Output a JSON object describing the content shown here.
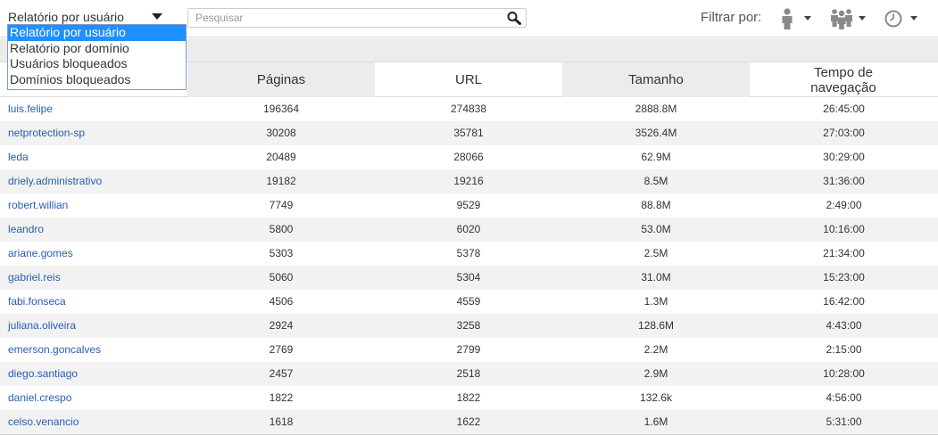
{
  "toolbar": {
    "report_select_value": "Relatório por usuário",
    "search_placeholder": "Pesquisar",
    "filter_label": "Filtrar por:",
    "filter_icons": [
      "user-icon",
      "group-icon",
      "clock-icon"
    ]
  },
  "dropdown": {
    "options": [
      "Relatório por usuário",
      "Relatório por domínio",
      "Usuários bloqueados",
      "Domínios bloqueados"
    ],
    "selected_index": 0,
    "highlight_color": "#1e90ff"
  },
  "table": {
    "headers": [
      "Páginas",
      "URL",
      "Tamanho",
      "Tempo de navegação"
    ],
    "rows": [
      {
        "user": "luis.felipe",
        "paginas": "196364",
        "url": "274838",
        "tamanho": "2888.8M",
        "tempo": "26:45:00"
      },
      {
        "user": "netprotection-sp",
        "paginas": "30208",
        "url": "35781",
        "tamanho": "3526.4M",
        "tempo": "27:03:00"
      },
      {
        "user": "leda",
        "paginas": "20489",
        "url": "28066",
        "tamanho": "62.9M",
        "tempo": "30:29:00"
      },
      {
        "user": "driely.administrativo",
        "paginas": "19182",
        "url": "19216",
        "tamanho": "8.5M",
        "tempo": "31:36:00"
      },
      {
        "user": "robert.willian",
        "paginas": "7749",
        "url": "9529",
        "tamanho": "88.8M",
        "tempo": "2:49:00"
      },
      {
        "user": "leandro",
        "paginas": "5800",
        "url": "6020",
        "tamanho": "53.0M",
        "tempo": "10:16:00"
      },
      {
        "user": "ariane.gomes",
        "paginas": "5303",
        "url": "5378",
        "tamanho": "2.5M",
        "tempo": "21:34:00"
      },
      {
        "user": "gabriel.reis",
        "paginas": "5060",
        "url": "5304",
        "tamanho": "31.0M",
        "tempo": "15:23:00"
      },
      {
        "user": "fabi.fonseca",
        "paginas": "4506",
        "url": "4559",
        "tamanho": "1.3M",
        "tempo": "16:42:00"
      },
      {
        "user": "juliana.oliveira",
        "paginas": "2924",
        "url": "3258",
        "tamanho": "128.6M",
        "tempo": "4:43:00"
      },
      {
        "user": "emerson.goncalves",
        "paginas": "2769",
        "url": "2799",
        "tamanho": "2.2M",
        "tempo": "2:15:00"
      },
      {
        "user": "diego.santiago",
        "paginas": "2457",
        "url": "2518",
        "tamanho": "2.9M",
        "tempo": "10:28:00"
      },
      {
        "user": "daniel.crespo",
        "paginas": "1822",
        "url": "1822",
        "tamanho": "132.6k",
        "tempo": "4:56:00"
      },
      {
        "user": "celso.venancio",
        "paginas": "1618",
        "url": "1622",
        "tamanho": "1.6M",
        "tempo": "5:31:00"
      }
    ]
  }
}
